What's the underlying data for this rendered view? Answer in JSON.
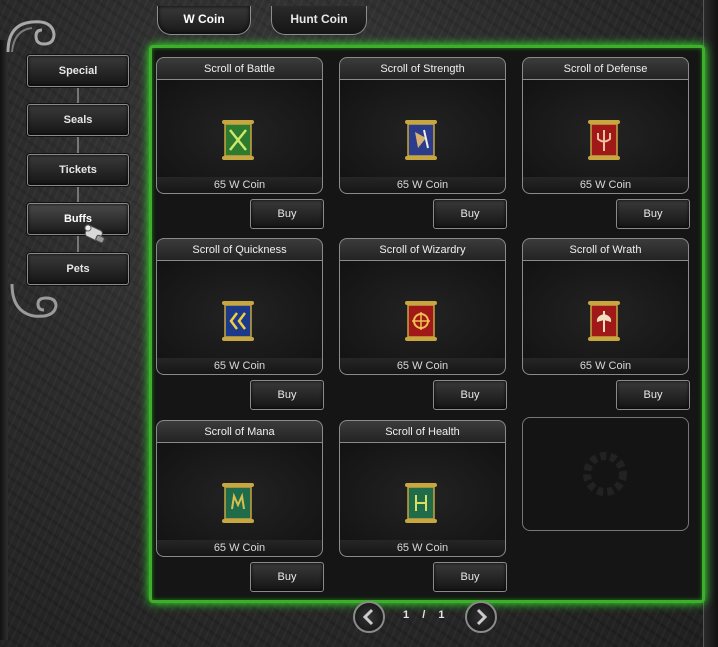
{
  "tabs": [
    {
      "label": "W Coin",
      "active": true
    },
    {
      "label": "Hunt Coin",
      "active": false
    }
  ],
  "categories": [
    {
      "label": "Special",
      "active": false
    },
    {
      "label": "Seals",
      "active": false
    },
    {
      "label": "Tickets",
      "active": false
    },
    {
      "label": "Buffs",
      "active": true
    },
    {
      "label": "Pets",
      "active": false
    }
  ],
  "items": [
    {
      "name": "Scroll of Battle",
      "price": "65 W Coin",
      "buy_label": "Buy",
      "icon": "crossed-swords-scroll-icon",
      "color": "#2e7a2e"
    },
    {
      "name": "Scroll of Strength",
      "price": "65 W Coin",
      "buy_label": "Buy",
      "icon": "fist-scroll-icon",
      "color": "#2c3c8a"
    },
    {
      "name": "Scroll of Defense",
      "price": "65 W Coin",
      "buy_label": "Buy",
      "icon": "shield-trident-scroll-icon",
      "color": "#a01818"
    },
    {
      "name": "Scroll of Quickness",
      "price": "65 W Coin",
      "buy_label": "Buy",
      "icon": "double-chevron-scroll-icon",
      "color": "#1d3a8a"
    },
    {
      "name": "Scroll of Wizardry",
      "price": "65 W Coin",
      "buy_label": "Buy",
      "icon": "rune-circle-scroll-icon",
      "color": "#a01818"
    },
    {
      "name": "Scroll of Wrath",
      "price": "65 W Coin",
      "buy_label": "Buy",
      "icon": "axe-scroll-icon",
      "color": "#a01818"
    },
    {
      "name": "Scroll of Mana",
      "price": "65 W Coin",
      "buy_label": "Buy",
      "icon": "mana-rune-scroll-icon",
      "color": "#1f6b4a"
    },
    {
      "name": "Scroll of Health",
      "price": "65 W Coin",
      "buy_label": "Buy",
      "icon": "health-rune-scroll-icon",
      "color": "#1f6b4a"
    }
  ],
  "pagination": {
    "current": "1",
    "separator": "/",
    "total": "1"
  },
  "colors": {
    "panel_glow": "#35ff2a",
    "panel_border": "#3fae2b",
    "gold_trim": "#c8a640"
  }
}
